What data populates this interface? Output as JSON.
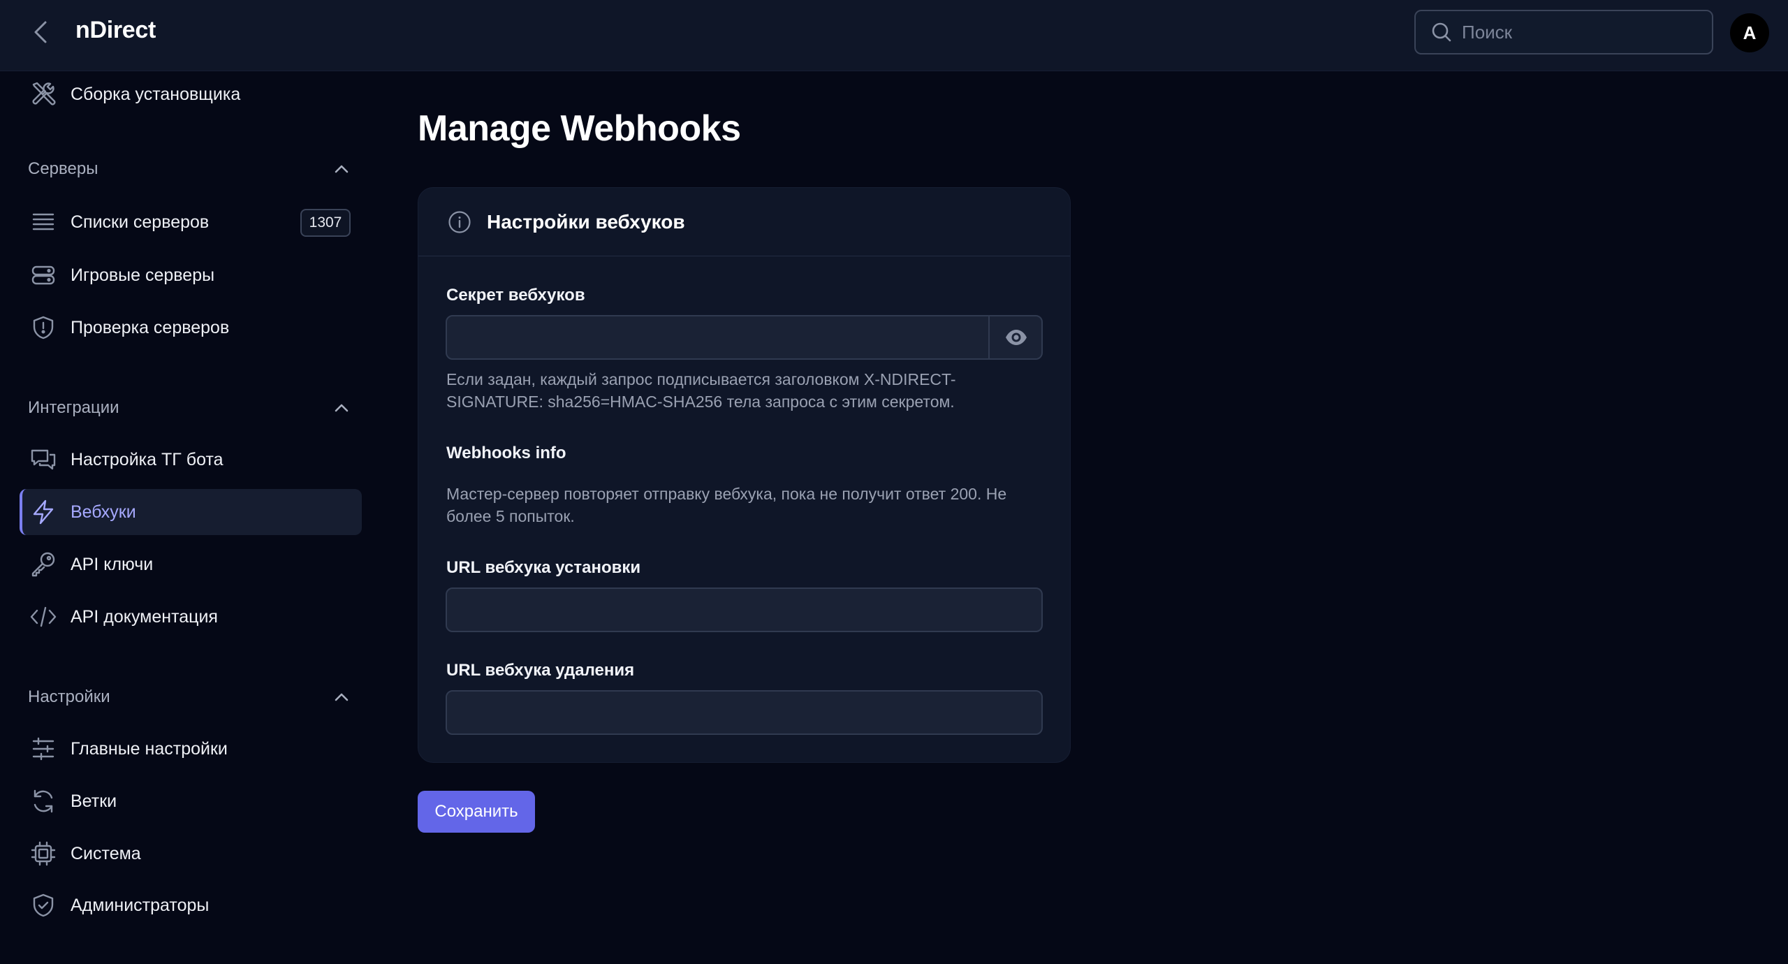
{
  "header": {
    "brand": "nDirect",
    "search_placeholder": "Поиск",
    "avatar_letter": "A"
  },
  "sidebar": {
    "top_item": {
      "label": "Сборка установщика",
      "icon": "tools-icon"
    },
    "sections": [
      {
        "title": "Серверы",
        "items": [
          {
            "label": "Списки серверов",
            "icon": "server-list-icon",
            "badge": "1307"
          },
          {
            "label": "Игровые серверы",
            "icon": "server-stack-icon"
          },
          {
            "label": "Проверка серверов",
            "icon": "shield-alert-icon"
          }
        ]
      },
      {
        "title": "Интеграции",
        "items": [
          {
            "label": "Настройка ТГ бота",
            "icon": "chat-icon"
          },
          {
            "label": "Вебхуки",
            "icon": "bolt-icon",
            "active": true
          },
          {
            "label": "API ключи",
            "icon": "key-icon"
          },
          {
            "label": "API документация",
            "icon": "code-icon"
          }
        ]
      },
      {
        "title": "Настройки",
        "items": [
          {
            "label": "Главные настройки",
            "icon": "sliders-icon"
          },
          {
            "label": "Ветки",
            "icon": "refresh-icon"
          },
          {
            "label": "Система",
            "icon": "cpu-icon"
          },
          {
            "label": "Администраторы",
            "icon": "shield-check-icon"
          }
        ]
      }
    ]
  },
  "main": {
    "title": "Manage Webhooks",
    "card": {
      "title": "Настройки вебхуков",
      "secret_label": "Секрет вебхуков",
      "secret_value": "",
      "secret_help": "Если задан, каждый запрос подписывается заголовком X-NDIRECT-SIGNATURE: sha256=HMAC-SHA256 тела запроса с этим секретом.",
      "info_label": "Webhooks info",
      "info_text": "Мастер-сервер повторяет отправку вебхука, пока не получит ответ 200. Не более 5 попыток.",
      "install_label": "URL вебхука установки",
      "install_value": "",
      "delete_label": "URL вебхука удаления",
      "delete_value": ""
    },
    "save_label": "Сохранить"
  },
  "colors": {
    "accent": "#6366e8",
    "active_text": "#a6a9ff",
    "background": "#050816",
    "panel": "#0f1628"
  }
}
